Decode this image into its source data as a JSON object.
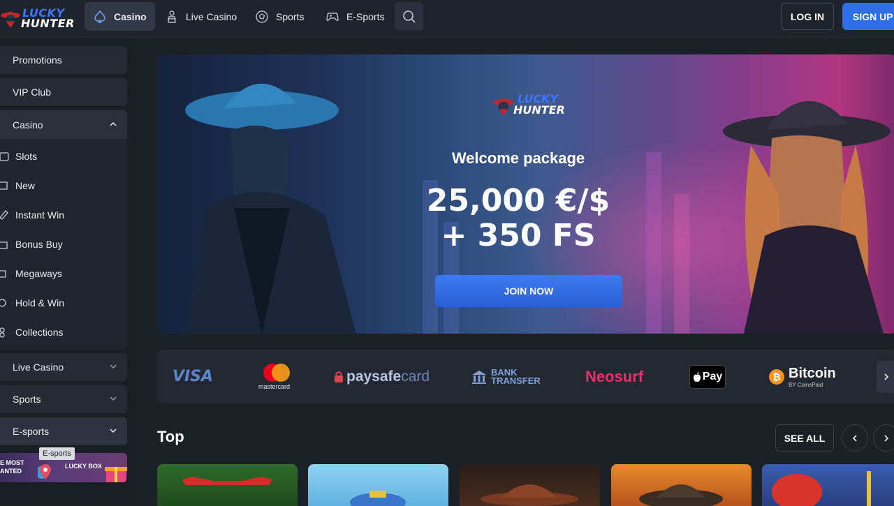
{
  "brand": {
    "word1": "LUCKY",
    "word2": "HUNTER"
  },
  "nav": {
    "items": [
      {
        "label": "Casino",
        "icon": "spade-icon",
        "active": true
      },
      {
        "label": "Live Casino",
        "icon": "dealer-icon",
        "active": false
      },
      {
        "label": "Sports",
        "icon": "soccer-ball-icon",
        "active": false
      },
      {
        "label": "E-Sports",
        "icon": "gamepad-icon",
        "active": false
      }
    ],
    "search_icon": "search-icon",
    "login_label": "LOG IN",
    "signup_label": "SIGN UP"
  },
  "sidebar": {
    "top_items": [
      {
        "label": "Promotions"
      },
      {
        "label": "VIP Club"
      }
    ],
    "casino": {
      "label": "Casino",
      "expanded": true,
      "sub_items": [
        {
          "label": "Slots",
          "icon": "slots-icon"
        },
        {
          "label": "New",
          "icon": "new-icon"
        },
        {
          "label": "Instant Win",
          "icon": "rocket-icon"
        },
        {
          "label": "Bonus Buy",
          "icon": "bag-icon"
        },
        {
          "label": "Megaways",
          "icon": "megaways-icon"
        },
        {
          "label": "Hold & Win",
          "icon": "coins-icon"
        },
        {
          "label": "Collections",
          "icon": "collections-icon"
        }
      ]
    },
    "bottom_items": [
      {
        "label": "Live Casino"
      },
      {
        "label": "Sports"
      },
      {
        "label": "E-sports"
      }
    ],
    "tooltip": "E-sports",
    "promo": {
      "left_text_1": "E MOST",
      "left_text_2": "ANTED",
      "right_text": "LUCKY BOX"
    }
  },
  "hero": {
    "title": "Welcome package",
    "amount": "25,000 €/$",
    "free_spins": "+ 350 FS",
    "cta": "JOIN NOW"
  },
  "payments": {
    "visa": "VISA",
    "mastercard": "mastercard",
    "paysafe": "paysafe",
    "paysafe_card": "card",
    "bank_line1": "BANK",
    "bank_line2": "TRANSFER",
    "neosurf": "Neosurf",
    "applepay": "Pay",
    "bitcoin": "Bitcoin",
    "bitcoin_sub": "BY CoinsPaid"
  },
  "top_section": {
    "title": "Top",
    "see_all": "SEE ALL"
  },
  "colors": {
    "accent": "#2f6ee8",
    "background": "#1c2027",
    "sidebar": "#1a1e25",
    "neosurf": "#e8306b",
    "bitcoin": "#f7931a"
  }
}
